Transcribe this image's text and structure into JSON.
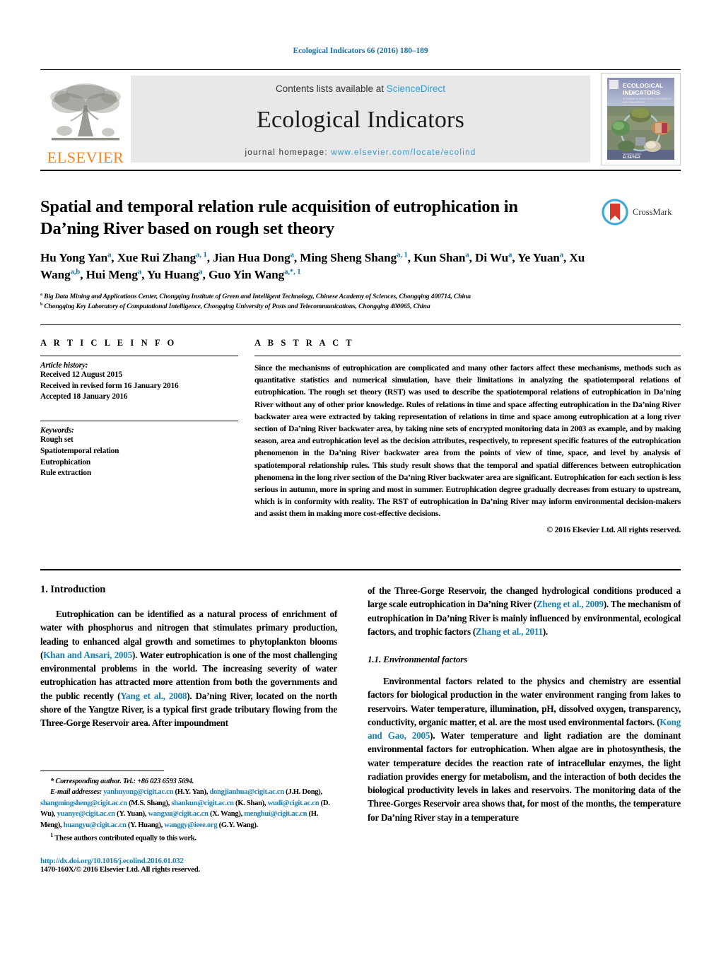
{
  "running_head": "Ecological Indicators 66 (2016) 180–189",
  "masthead": {
    "contents_prefix": "Contents lists available at ",
    "sciencedirect": "ScienceDirect",
    "journal_title": "Ecological Indicators",
    "homepage_prefix": "journal homepage: ",
    "homepage_url": "www.elsevier.com/locate/ecolind",
    "publisher_wordmark": "ELSEVIER",
    "publisher_color": "#F58220",
    "link_color": "#2e9bd6",
    "cover": {
      "title_line1": "ECOLOGICAL",
      "title_line2": "INDICATORS",
      "subtitle": "INTEGRATING MONITORING, ASSESSMENT AND MANAGEMENT",
      "footer": "ELSEVIER"
    }
  },
  "article": {
    "title": "Spatial and temporal relation rule acquisition of eutrophication in Da’ning River based on rough set theory",
    "crossmark_label": "CrossMark",
    "authors_html": "Hu Yong Yan<sup>a</sup>, Xue Rui Zhang<sup>a, 1</sup>, Jian Hua Dong<sup>a</sup>, Ming Sheng Shang<sup>a, 1</sup>, Kun Shan<sup>a</sup>, Di Wu<sup>a</sup>, Ye Yuan<sup>a</sup>, Xu Wang<sup>a,b</sup>, Hui Meng<sup>a</sup>, Yu Huang<sup>a</sup>, Guo Yin Wang<sup>a,*, 1</sup>",
    "affiliation_a": "Big Data Mining and Applications Center, Chongqing Institute of Green and Intelligent Technology, Chinese Academy of Sciences, Chongqing 400714, China",
    "affiliation_b": "Chongqing Key Laboratory of Computational Intelligence, Chongqing University of Posts and Telecommunications, Chongqing 400065, China"
  },
  "article_info": {
    "heading": "A R T I C L E  I N F O",
    "history_label": "Article history:",
    "history": [
      "Received 12 August 2015",
      "Received in revised form 16 January 2016",
      "Accepted 18 January 2016"
    ],
    "keywords_label": "Keywords:",
    "keywords": [
      "Rough set",
      "Spatiotemporal relation",
      "Eutrophication",
      "Rule extraction"
    ]
  },
  "abstract": {
    "heading": "A B S T R A C T",
    "text": "Since the mechanisms of eutrophication are complicated and many other factors affect these mechanisms, methods such as quantitative statistics and numerical simulation, have their limitations in analyzing the spatiotemporal relations of eutrophication. The rough set theory (RST) was used to describe the spatiotemporal relations of eutrophication in Da’ning River without any of other prior knowledge. Rules of relations in time and space affecting eutrophication in the Da’ning River backwater area were extracted by taking representation of relations in time and space among eutrophication at a long river section of Da’ning River backwater area, by taking nine sets of encrypted monitoring data in 2003 as example, and by making season, area and eutrophication level as the decision attributes, respectively, to represent specific features of the eutrophication phenomenon in the Da’ning River backwater area from the points of view of time, space, and level by analysis of spatiotemporal relationship rules. This study result shows that the temporal and spatial differences between eutrophication phenomena in the long river section of the Da’ning River backwater area are significant. Eutrophication for each section is less serious in autumn, more in spring and most in summer. Eutrophication degree gradually decreases from estuary to upstream, which is in conformity with reality. The RST of eutrophication in Da’ning River may inform environmental decision-makers and assist them in making more cost-effective decisions.",
    "copyright": "© 2016 Elsevier Ltd. All rights reserved."
  },
  "body": {
    "section1_heading": "1.  Introduction",
    "p1_html": "Eutrophication can be identified as a natural process of enrichment of water with phosphorus and nitrogen that stimulates primary production, leading to enhanced algal growth and sometimes to phytoplankton blooms (<span class=\"ref\">Khan and Ansari, 2005</span>). Water eutrophication is one of the most challenging environmental problems in the world. The increasing severity of water eutrophication has attracted more attention from both the governments and the public recently (<span class=\"ref\">Yang et al., 2008</span>). Da’ning River, located on the north shore of the Yangtze River, is a typical first grade tributary flowing from the Three-Gorge Reservoir area. After impoundment",
    "p1_cont_html": "of the Three-Gorge Reservoir, the changed hydrological conditions produced a large scale eutrophication in Da’ning River (<span class=\"ref\">Zheng et al., 2009</span>). The mechanism of eutrophication in Da’ning River is mainly influenced by environmental, ecological factors, and trophic factors (<span class=\"ref\">Zhang et al., 2011</span>).",
    "subsection11_heading": "1.1.  Environmental factors",
    "p2_html": "Environmental factors related to the physics and chemistry are essential factors for biological production in the water environment ranging from lakes to reservoirs. Water temperature, illumination, pH, dissolved oxygen, transparency, conductivity, organic matter, et al. are the most used environmental factors. (<span class=\"ref\">Kong and Gao, 2005</span>). Water temperature and light radiation are the dominant environmental factors for eutrophication. When algae are in photosynthesis, the water temperature decides the reaction rate of intracellular enzymes, the light radiation provides energy for metabolism, and the interaction of both decides the biological productivity levels in lakes and reservoirs. The monitoring data of the Three-Gorges Reservoir area shows that, for most of the months, the temperature for Da’ning River stay in a temperature"
  },
  "footnotes": {
    "corresponding_html": "<span class=\"ital\">*  Corresponding author. Tel.: +86 023 6593 5694.</span>",
    "emails_html": "<span class=\"ital\">E-mail addresses:</span> <span class=\"mail\">yanhuyong@cigit.ac.cn</span> (H.Y. Yan), <span class=\"mail\">dongjianhua@cigit.ac.cn</span> (J.H. Dong), <span class=\"mail\">shangmingsheng@cigit.ac.cn</span> (M.S. Shang), <span class=\"mail\">shankun@cigit.ac.cn</span> (K. Shan), <span class=\"mail\">wudi@cigit.ac.cn</span> (D. Wu), <span class=\"mail\">yuanye@cigit.ac.cn</span> (Y. Yuan), <span class=\"mail\">wangxu@cigit.ac.cn</span> (X. Wang), <span class=\"mail\">menghui@cigit.ac.cn</span> (H. Meng), <span class=\"mail\">huangyu@cigit.ac.cn</span> (Y. Huang), <span class=\"mail\">wanggy@ieee.org</span> (G.Y. Wang).",
    "equal_contrib_html": "<sup>1</sup>  These authors contributed equally to this work."
  },
  "doi_block": {
    "doi": "http://dx.doi.org/10.1016/j.ecolind.2016.01.032",
    "issn_line": "1470-160X/© 2016 Elsevier Ltd. All rights reserved."
  }
}
